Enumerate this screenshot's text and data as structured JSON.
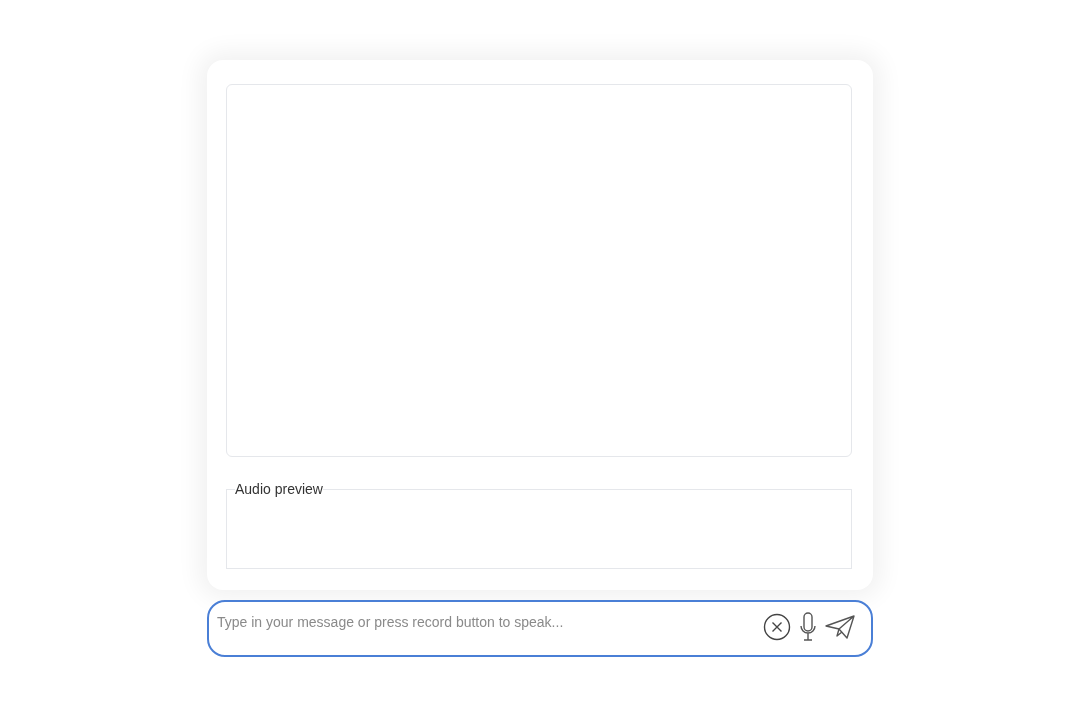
{
  "audio_preview": {
    "label": "Audio preview"
  },
  "message_input": {
    "placeholder": "Type in your message or press record button to speak..."
  }
}
